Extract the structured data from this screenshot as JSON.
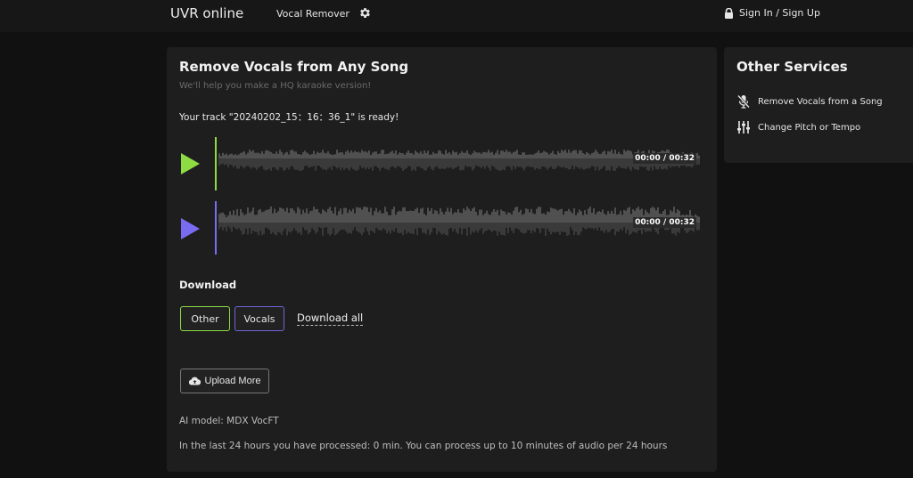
{
  "header": {
    "brand": "UVR online",
    "nav_link": "Vocal Remover",
    "signin": "Sign In / Sign Up"
  },
  "main": {
    "title": "Remove Vocals from Any Song",
    "subtitle": "We'll help you make a HQ karaoke version!",
    "ready_text": "Your track \"20240202_15：16：36_1\" is ready!",
    "tracks": [
      {
        "name": "Other",
        "time": "00:00 / 00:32",
        "color": "#8ddc44",
        "progress": 0
      },
      {
        "name": "Vocals",
        "time": "00:00 / 00:32",
        "color": "#7a6cf0",
        "progress": 0
      }
    ],
    "download_label": "Download",
    "download_other": "Other",
    "download_vocals": "Vocals",
    "download_all": "Download all",
    "upload_more": "Upload More",
    "model": "AI model: MDX VocFT",
    "limit": "In the last 24 hours you have processed: 0 min. You can process up to 10 minutes of audio per 24 hours"
  },
  "side": {
    "title": "Other Services",
    "services": [
      {
        "label": "Remove Vocals from a Song",
        "icon": "mic-off-icon"
      },
      {
        "label": "Change Pitch or Tempo",
        "icon": "sliders-icon"
      }
    ]
  },
  "colors": {
    "accent_other": "#8ddc44",
    "accent_vocals": "#7a6cf0",
    "background": "#111111",
    "card": "#1e1e1e"
  }
}
